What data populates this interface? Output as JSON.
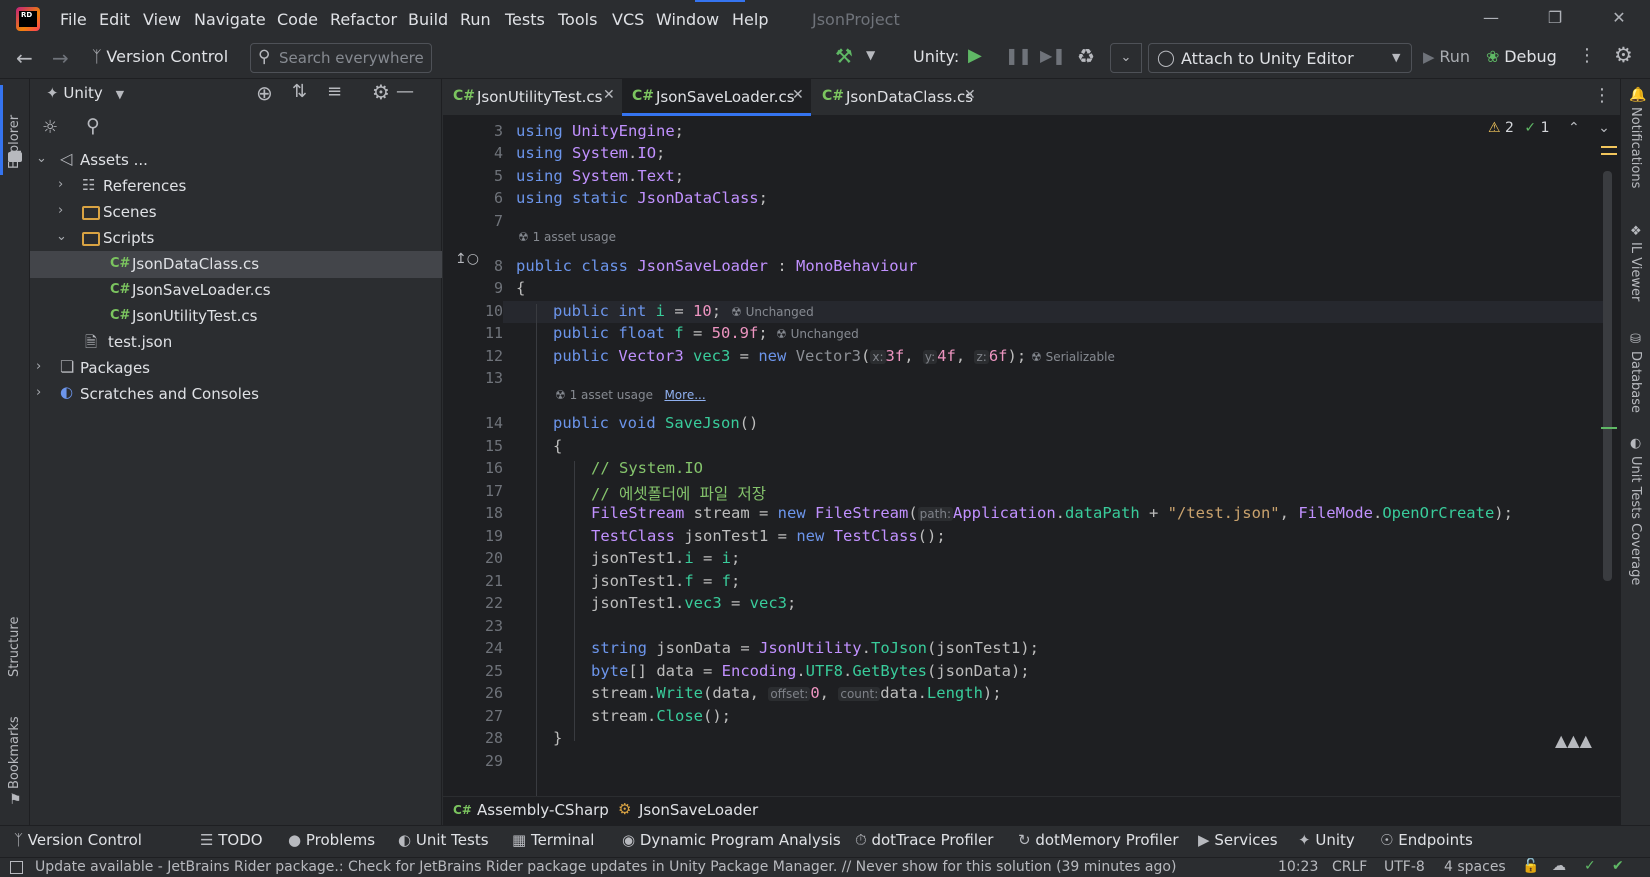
{
  "menu": [
    "File",
    "Edit",
    "View",
    "Navigate",
    "Code",
    "Refactor",
    "Build",
    "Run",
    "Tests",
    "Tools",
    "VCS",
    "Window",
    "Help"
  ],
  "project_name": "JsonProject",
  "logo_text": "RD",
  "toolbar": {
    "vcs_label": "Version Control",
    "search_placeholder": "Search everywhere",
    "unity_label": "Unity:",
    "attach_label": "Attach to Unity Editor",
    "run_label": "Run",
    "debug_label": "Debug"
  },
  "explorer": {
    "header": "Unity",
    "tree": [
      {
        "label": "Assets ...",
        "kind": "assets",
        "expanded": true
      },
      {
        "label": "References",
        "kind": "refs"
      },
      {
        "label": "Scenes",
        "kind": "folder"
      },
      {
        "label": "Scripts",
        "kind": "folder",
        "expanded": true
      },
      {
        "label": "JsonDataClass.cs",
        "kind": "cs",
        "selected": true
      },
      {
        "label": "JsonSaveLoader.cs",
        "kind": "cs"
      },
      {
        "label": "JsonUtilityTest.cs",
        "kind": "cs"
      },
      {
        "label": "test.json",
        "kind": "json"
      },
      {
        "label": "Packages",
        "kind": "packages"
      },
      {
        "label": "Scratches and Consoles",
        "kind": "scratch"
      }
    ]
  },
  "tabs": [
    {
      "label": "JsonUtilityTest.cs",
      "active": false
    },
    {
      "label": "JsonSaveLoader.cs",
      "active": true
    },
    {
      "label": "JsonDataClass.cs",
      "active": false
    }
  ],
  "tab_prefix": "C#",
  "inspections": {
    "warnings": "2",
    "ok": "1"
  },
  "lens": {
    "asset_usage": "1 asset usage",
    "more": "More...",
    "unchanged": "Unchanged",
    "serializable": "Serializable"
  },
  "line_numbers": [
    "3",
    "4",
    "5",
    "6",
    "7",
    "8",
    "9",
    "10",
    "11",
    "12",
    "13",
    "14",
    "15",
    "16",
    "17",
    "18",
    "19",
    "20",
    "21",
    "22",
    "23",
    "24",
    "25",
    "26",
    "27",
    "28",
    "29"
  ],
  "breadcrumb": {
    "project": "Assembly-CSharp",
    "class": "JsonSaveLoader"
  },
  "left_strip": {
    "explorer": "Explorer",
    "structure": "Structure",
    "bookmarks": "Bookmarks"
  },
  "right_strip": {
    "notifications": "Notifications",
    "il_viewer": "IL Viewer",
    "database": "Database",
    "unit_tests": "Unit Tests Coverage"
  },
  "tool_windows": [
    "Version Control",
    "TODO",
    "Problems",
    "Unit Tests",
    "Terminal",
    "Dynamic Program Analysis",
    "dotTrace Profiler",
    "dotMemory Profiler",
    "Services",
    "Unity",
    "Endpoints"
  ],
  "status": {
    "message": "Update available - JetBrains Rider package.: Check for JetBrains Rider package updates in Unity Package Manager. // Never show for this solution (39 minutes ago)",
    "position": "10:23",
    "line_ending": "CRLF",
    "encoding": "UTF-8",
    "indent": "4 spaces"
  },
  "colors": {
    "accent": "#3574f0",
    "bg": "#2b2d30",
    "editor_bg": "#1e1f22",
    "keyword": "#6c95eb",
    "type": "#c191ff",
    "method": "#39cc9b",
    "number": "#ed94c0",
    "string": "#c9a26d",
    "comment": "#85c46c"
  }
}
